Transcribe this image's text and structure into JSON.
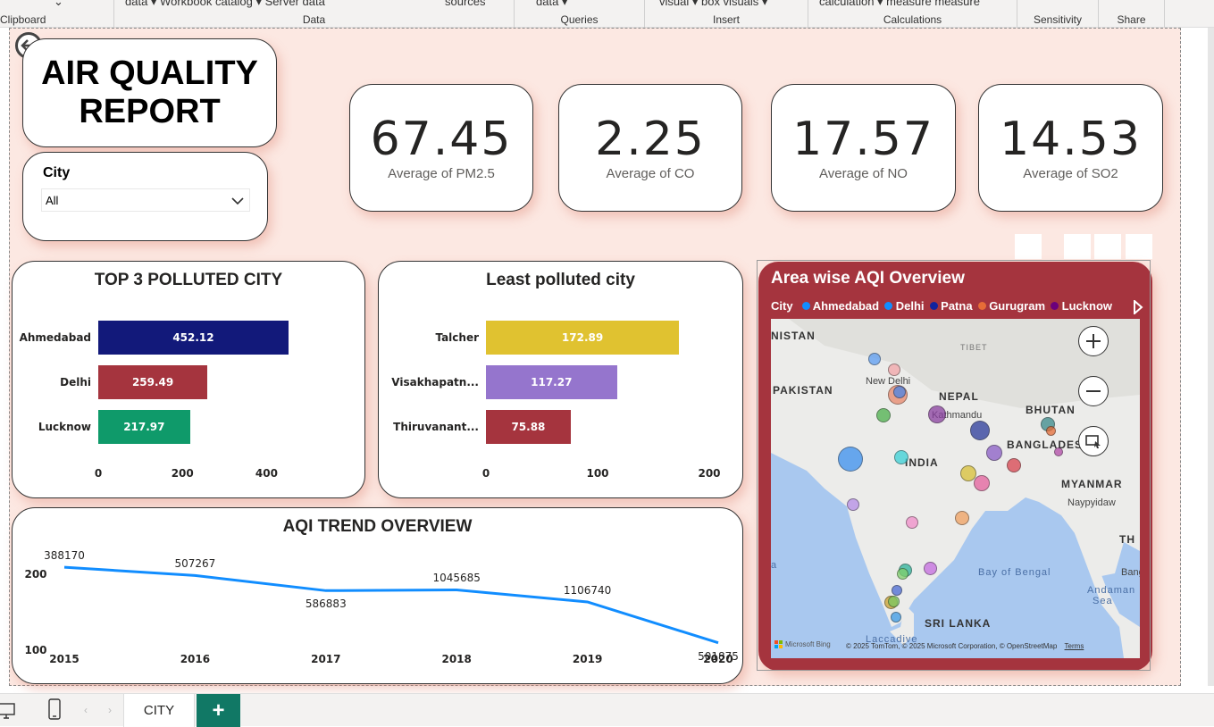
{
  "ribbon": {
    "groups": [
      {
        "top": "data ▾   Workbook catalog ▾   Server   data",
        "label": "Data"
      },
      {
        "top": "sources",
        "label": ""
      },
      {
        "top": "data ▾",
        "label": "Queries"
      },
      {
        "top": "visual ▾   box   visuals ▾",
        "label": "Insert"
      },
      {
        "top": "calculation ▾   measure  measure",
        "label": "Calculations"
      },
      {
        "top": "",
        "label": "Sensitivity"
      },
      {
        "top": "",
        "label": "Share"
      }
    ],
    "clipboard_label": "Clipboard"
  },
  "report": {
    "title_line1": "AIR QUALITY",
    "title_line2": "REPORT"
  },
  "slicer": {
    "label": "City",
    "value": "All"
  },
  "kpis": [
    {
      "value": "67.45",
      "label": "Average of PM2.5"
    },
    {
      "value": "2.25",
      "label": "Average of CO"
    },
    {
      "value": "17.57",
      "label": "Average of NO"
    },
    {
      "value": "14.53",
      "label": "Average of SO2"
    }
  ],
  "top3": {
    "title": "TOP 3 POLLUTED CITY",
    "ticks": [
      "0",
      "200",
      "400"
    ]
  },
  "least": {
    "title": "Least polluted city",
    "ticks": [
      "0",
      "100",
      "200"
    ]
  },
  "trend": {
    "title": "AQI TREND OVERVIEW",
    "y_ticks": [
      "200",
      "100"
    ],
    "labels": [
      "388170",
      "507267",
      "586883",
      "1045685",
      "1106740",
      "501875"
    ]
  },
  "map": {
    "title": "Area wise AQI Overview",
    "legend_title": "City",
    "legend": [
      {
        "name": "Ahmedabad",
        "color": "#118dff"
      },
      {
        "name": "Delhi",
        "color": "#118dff"
      },
      {
        "name": "Patna",
        "color": "#12239e"
      },
      {
        "name": "Gurugram",
        "color": "#e66c37"
      },
      {
        "name": "Lucknow",
        "color": "#6b007b"
      }
    ],
    "places": [
      {
        "name": "NISTAN",
        "style": "country"
      },
      {
        "name": "PAKISTAN",
        "style": "country"
      },
      {
        "name": "TIBET",
        "style": "region"
      },
      {
        "name": "New Delhi",
        "style": "city"
      },
      {
        "name": "NEPAL",
        "style": "country"
      },
      {
        "name": "Kathmandu",
        "style": "city"
      },
      {
        "name": "BHUTAN",
        "style": "country"
      },
      {
        "name": "BANGLADESH",
        "style": "country"
      },
      {
        "name": "INDIA",
        "style": "country"
      },
      {
        "name": "MYANMAR",
        "style": "country"
      },
      {
        "name": "Naypyidaw",
        "style": "city"
      },
      {
        "name": "Bay of Bengal",
        "style": "water"
      },
      {
        "name": "Andaman",
        "style": "water"
      },
      {
        "name": "Sea",
        "style": "water"
      },
      {
        "name": "TH",
        "style": "country"
      },
      {
        "name": "Bang",
        "style": "city"
      },
      {
        "name": "SRI LANKA",
        "style": "country"
      },
      {
        "name": "Laccadive",
        "style": "water"
      },
      {
        "name": "a",
        "style": "water"
      }
    ],
    "attribution": "© 2025 TomTom, © 2025 Microsoft Corporation, © OpenStreetMap",
    "terms": "Terms",
    "bing": "Microsoft Bing"
  },
  "footer": {
    "tab": "CITY",
    "add_label": "+"
  },
  "chart_data": [
    {
      "type": "bar",
      "title": "TOP 3 POLLUTED CITY",
      "orientation": "horizontal",
      "categories": [
        "Ahmedabad",
        "Delhi",
        "Lucknow"
      ],
      "values": [
        452.12,
        259.49,
        217.97
      ],
      "colors": [
        "#12197a",
        "#a5343e",
        "#0f9a6a"
      ],
      "xlim": [
        0,
        450
      ]
    },
    {
      "type": "bar",
      "title": "Least polluted city",
      "orientation": "horizontal",
      "categories": [
        "Talcher",
        "Visakhapatn...",
        "Thiruvanant..."
      ],
      "values": [
        172.89,
        117.27,
        75.88
      ],
      "colors": [
        "#e0c230",
        "#9575cd",
        "#a5343e"
      ],
      "xlim": [
        0,
        200
      ]
    },
    {
      "type": "line",
      "title": "AQI TREND OVERVIEW",
      "x": [
        "2015",
        "2016",
        "2017",
        "2018",
        "2019",
        "2020"
      ],
      "values": [
        211,
        200,
        180,
        181,
        165,
        111
      ],
      "labels": [
        "388170",
        "507267",
        "586883",
        "1045685",
        "1106740",
        "501875"
      ],
      "ylim": [
        100,
        230
      ],
      "color": "#118dff"
    }
  ]
}
